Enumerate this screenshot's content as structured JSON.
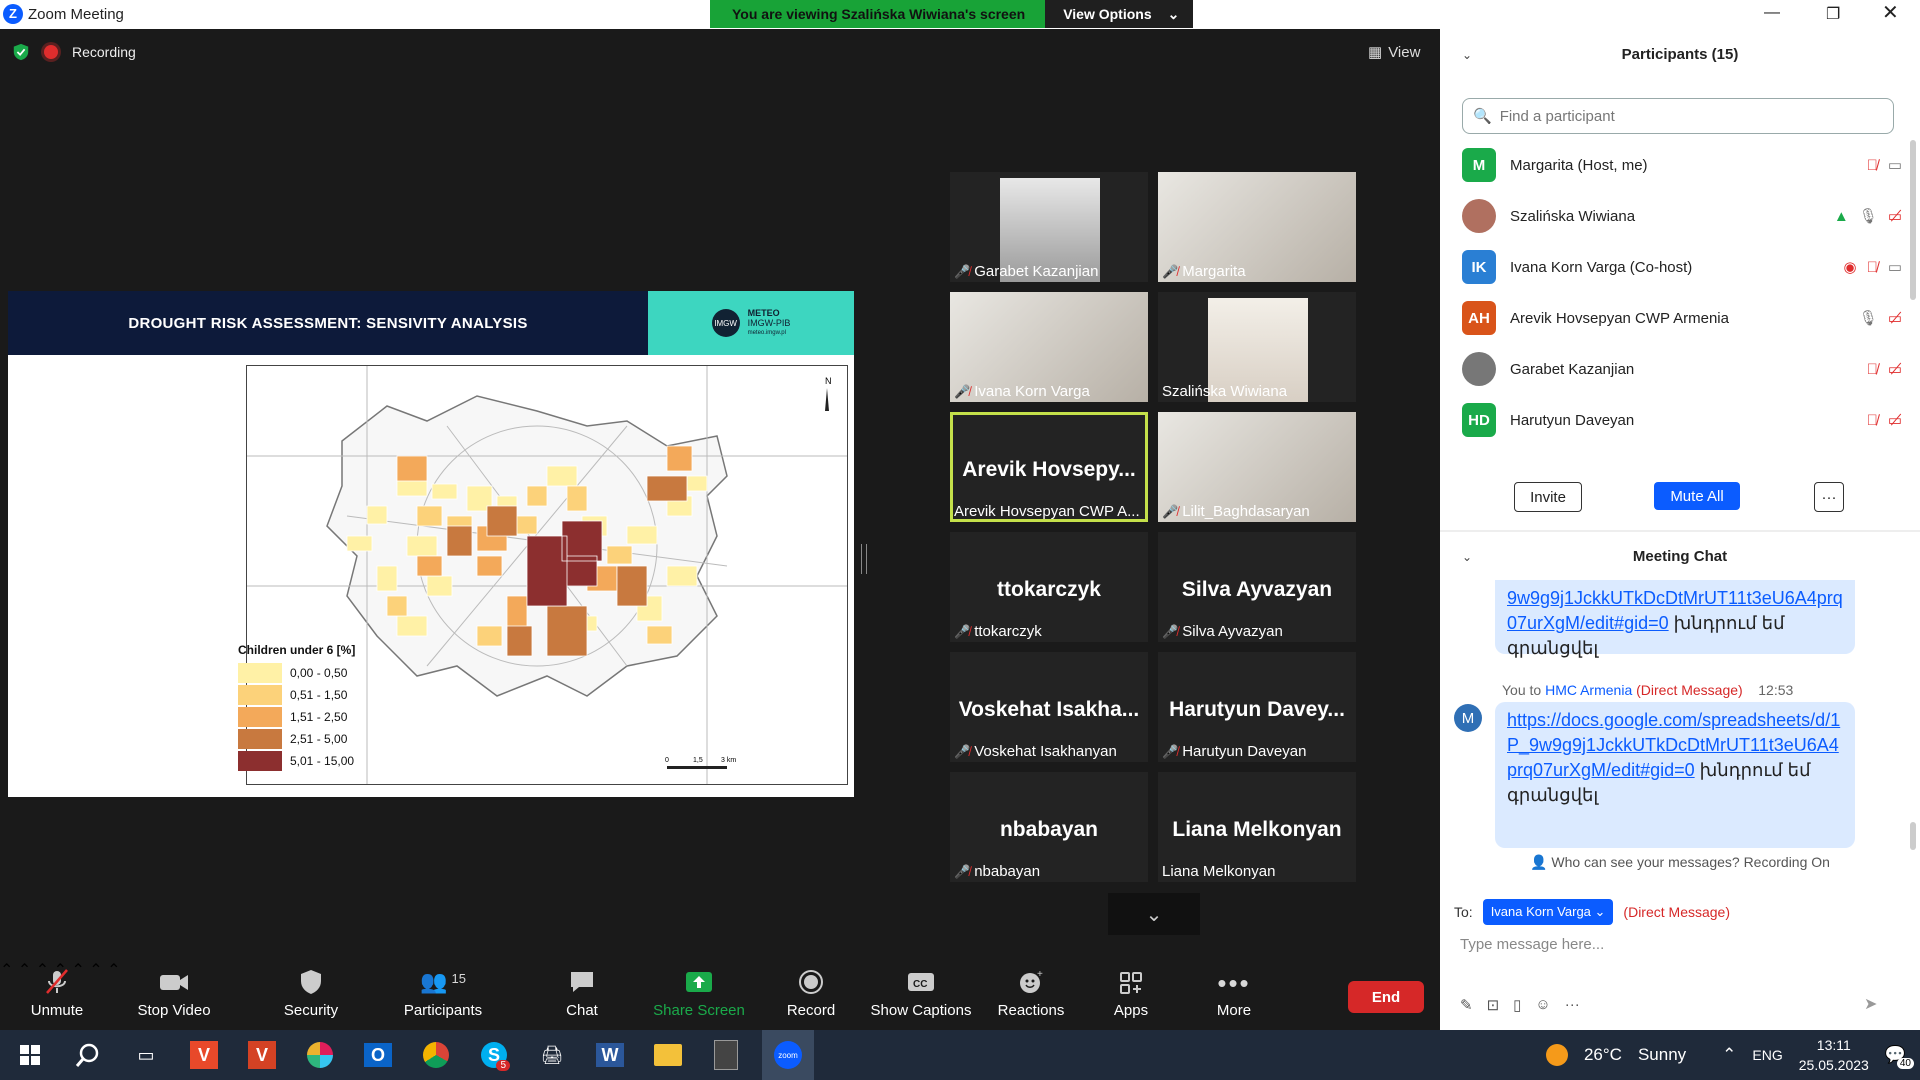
{
  "window": {
    "title": "Zoom Meeting",
    "logo_letter": "Z"
  },
  "banner": {
    "viewing_text": "You are viewing Szalińska Wiwiana's screen",
    "view_options_label": "View Options"
  },
  "share": {
    "recording_label": "Recording",
    "view_label": "View",
    "slide": {
      "title": "DROUGHT RISK ASSESSMENT: SENSIVITY ANALYSIS",
      "logo_circle": "IMGW",
      "logo_line1": "METEO",
      "logo_line2": "IMGW-PIB",
      "logo_line3": "meteo.imgw.pl",
      "legend_title": "Children under 6 [%]",
      "legend": [
        {
          "label": "0,00 - 0,50",
          "color": "#fff1a6"
        },
        {
          "label": "0,51 - 1,50",
          "color": "#fcd27a"
        },
        {
          "label": "1,51 - 2,50",
          "color": "#f3a95a"
        },
        {
          "label": "2,51 - 5,00",
          "color": "#c8793f"
        },
        {
          "label": "5,01 - 15,00",
          "color": "#8c2f2f"
        }
      ]
    }
  },
  "gallery": [
    {
      "name": "Garabet Kazanjian",
      "muted": true,
      "has_video": true
    },
    {
      "name": "Margarita",
      "muted": true,
      "has_video": true
    },
    {
      "name": "Ivana Korn Varga",
      "muted": true,
      "has_video": true
    },
    {
      "name": "Szalińska Wiwiana",
      "muted": false,
      "has_video": true
    },
    {
      "name": "Arevik Hovsepyan CWP A...",
      "big": "Arevik Hovsepy...",
      "muted": false,
      "active": true
    },
    {
      "name": "Lilit_Baghdasaryan",
      "muted": true,
      "has_video": true
    },
    {
      "name": "ttokarczyk",
      "big": "ttokarczyk",
      "muted": true
    },
    {
      "name": "Silva Ayvazyan",
      "big": "Silva Ayvazyan",
      "muted": true
    },
    {
      "name": "Voskehat Isakhanyan",
      "big": "Voskehat Isakha...",
      "muted": true
    },
    {
      "name": "Harutyun Daveyan",
      "big": "Harutyun Davey...",
      "muted": true
    },
    {
      "name": "nbabayan",
      "big": "nbabayan",
      "muted": true
    },
    {
      "name": "Liana Melkonyan",
      "big": "Liana Melkonyan",
      "muted": false
    }
  ],
  "toolbar": {
    "unmute": "Unmute",
    "stop_video": "Stop Video",
    "security": "Security",
    "participants": "Participants",
    "participants_count": "15",
    "chat": "Chat",
    "share_screen": "Share Screen",
    "record": "Record",
    "show_captions": "Show Captions",
    "reactions": "Reactions",
    "apps": "Apps",
    "more": "More",
    "end": "End"
  },
  "participants_panel": {
    "header": "Participants (15)",
    "search_placeholder": "Find a participant",
    "list": [
      {
        "initials": "M",
        "name": "Margarita (Host, me)",
        "color": "#1aaa4a"
      },
      {
        "initials": "",
        "name": "Szalińska Wiwiana",
        "color": "#b07060"
      },
      {
        "initials": "IK",
        "name": "Ivana Korn Varga (Co-host)",
        "color": "#2a7fd4"
      },
      {
        "initials": "AH",
        "name": "Arevik Hovsepyan CWP Armenia",
        "color": "#d9541a"
      },
      {
        "initials": "",
        "name": "Garabet Kazanjian",
        "color": "#777777"
      },
      {
        "initials": "HD",
        "name": "Harutyun Daveyan",
        "color": "#1aaa4a"
      }
    ],
    "invite": "Invite",
    "mute_all": "Mute All",
    "more": "···"
  },
  "chat": {
    "header": "Meeting Chat",
    "msg1_link_tail": "9w9g9j1JckkUTkDcDtMrUT11t3eU6A4prq07urXgM/edit#gid=0",
    "msg1_text": " խնդրում եմ գրանցվել",
    "meta_you": "You to ",
    "meta_to": "HMC Armenia",
    "meta_dm": " (Direct Message)",
    "meta_time": "12:53",
    "avatar": "M",
    "msg2_link": "https://docs.google.com/spreadsheets/d/1P_9w9g9j1JckkUTkDcDtMrUT11t3eU6A4prq07urXgM/edit#gid=0",
    "msg2_text": " խնդրում եմ գրանցվել",
    "who_can_see": "Who can see your messages? Recording On",
    "to_label": "To:",
    "to_target": "Ivana Korn Varga",
    "to_dm": "(Direct Message)",
    "placeholder": "Type message here..."
  },
  "taskbar": {
    "temperature": "26°C",
    "weather": "Sunny",
    "lang": "ENG",
    "time": "13:11",
    "date": "25.05.2023",
    "notifications": "40",
    "skype_badge": "5"
  }
}
